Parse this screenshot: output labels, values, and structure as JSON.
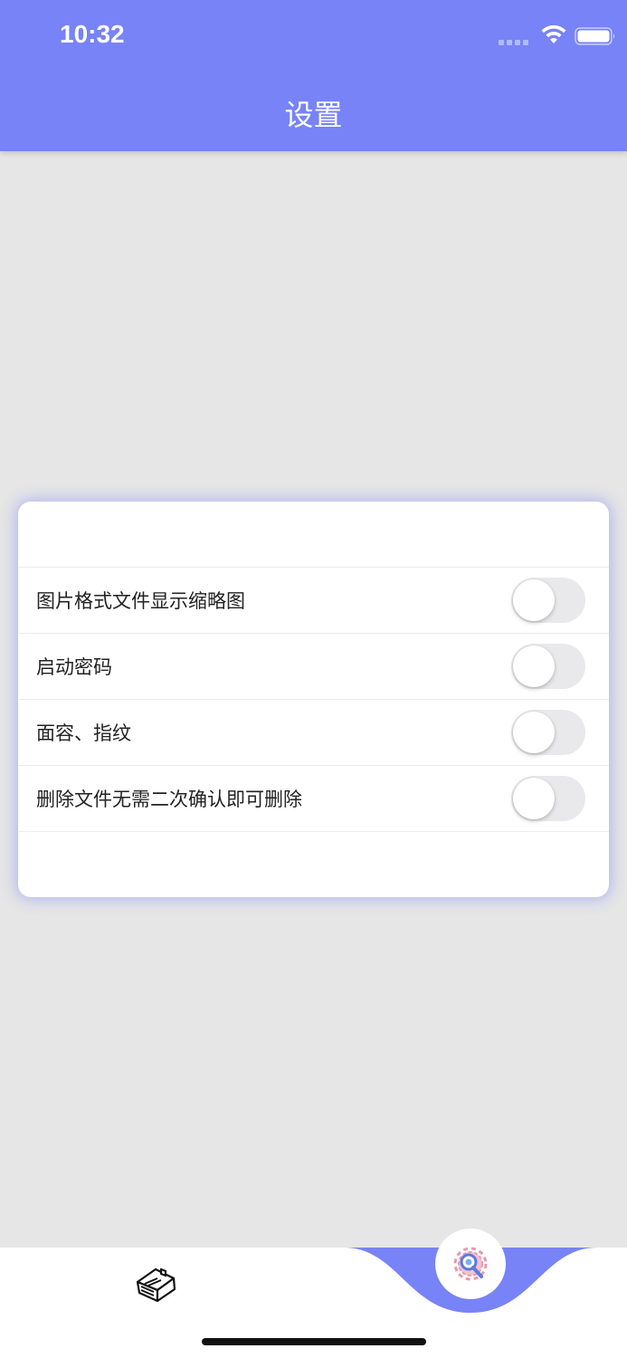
{
  "status_bar": {
    "time": "10:32"
  },
  "header": {
    "title": "设置"
  },
  "settings": [
    {
      "label": "图片格式文件显示缩略图",
      "on": false
    },
    {
      "label": "启动密码",
      "on": false
    },
    {
      "label": "面容、指纹",
      "on": false
    },
    {
      "label": "删除文件无需二次确认即可删除",
      "on": false
    }
  ],
  "tabbar": {
    "tabs": [
      {
        "icon": "home-icon",
        "selected": false
      },
      {
        "icon": "settings-gear-icon",
        "selected": true
      }
    ]
  },
  "colors": {
    "accent": "#7783f7",
    "background": "#e6e6e6",
    "card": "#ffffff",
    "toggle_off": "#e9e9eb"
  }
}
